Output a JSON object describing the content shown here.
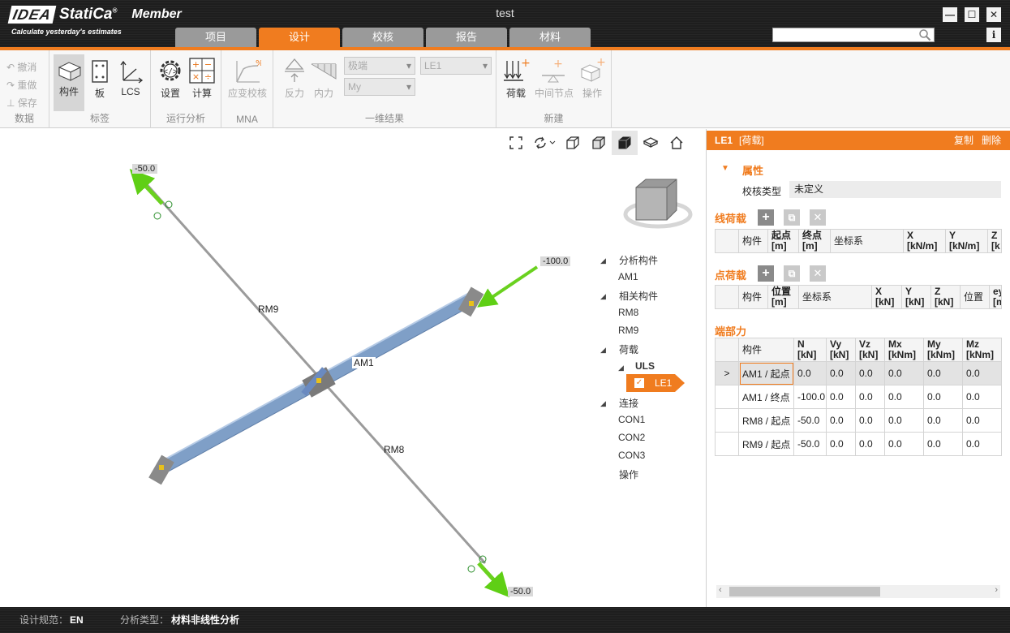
{
  "app": {
    "logo_idea": "IDEA",
    "logo_statica": "StatiCa",
    "logo_reg": "®",
    "product": "Member",
    "tagline": "Calculate yesterday's estimates",
    "document_title": "test"
  },
  "window": {
    "minimize": "—",
    "maximize": "☐",
    "close": "✕",
    "info": "i"
  },
  "search": {
    "value": "",
    "placeholder": ""
  },
  "tabs": [
    {
      "label": "项目",
      "active": false
    },
    {
      "label": "设计",
      "active": true
    },
    {
      "label": "校核",
      "active": false
    },
    {
      "label": "报告",
      "active": false
    },
    {
      "label": "材料",
      "active": false
    }
  ],
  "ribbon": {
    "data_group": {
      "undo": "撤消",
      "redo": "重做",
      "save": "保存",
      "label": "数据"
    },
    "labels_group": {
      "member": "构件",
      "plate": "板",
      "lcs": "LCS",
      "label": "标签"
    },
    "run_group": {
      "settings": "设置",
      "calculate": "计算",
      "label": "运行分析"
    },
    "mna_group": {
      "strain_check": "应变校核",
      "label": "MNA"
    },
    "results_group": {
      "reactions": "反力",
      "internal_forces": "内力",
      "extreme_dropdown": "极端",
      "my_dropdown": "My",
      "le1_dropdown": "LE1",
      "label": "一维结果"
    },
    "new_group": {
      "load": "荷载",
      "intermediate_node": "中间节点",
      "operation": "操作",
      "label": "新建"
    }
  },
  "viewport": {
    "load_labels": [
      "-50.0",
      "-100.0",
      "-50.0"
    ],
    "member_labels": [
      "RM9",
      "AM1",
      "RM8"
    ],
    "tree": {
      "analysis_members": "分析构件",
      "am1": "AM1",
      "related_members": "相关构件",
      "rm8": "RM8",
      "rm9": "RM9",
      "loads": "荷载",
      "uls": "ULS",
      "le1": "LE1",
      "connections": "连接",
      "con1": "CON1",
      "con2": "CON2",
      "con3": "CON3",
      "operations": "操作"
    }
  },
  "panel": {
    "header_title": "LE1",
    "header_type": "[荷载]",
    "copy": "复制",
    "delete": "删除",
    "properties_title": "属性",
    "check_type_label": "校核类型",
    "check_type_value": "未定义",
    "line_loads_title": "线荷载",
    "line_loads_columns": [
      "构件",
      "起点 [m]",
      "终点 [m]",
      "坐标系",
      "X [kN/m]",
      "Y [kN/m]",
      "Z [k"
    ],
    "point_loads_title": "点荷载",
    "point_loads_columns": [
      "构件",
      "位置 [m]",
      "坐标系",
      "X [kN]",
      "Y [kN]",
      "Z [kN]",
      "位置",
      "ey [m"
    ],
    "end_forces_title": "端部力",
    "end_forces_columns": [
      "构件",
      "N [kN]",
      "Vy [kN]",
      "Vz [kN]",
      "Mx [kNm]",
      "My [kNm]",
      "Mz [kNm]"
    ],
    "end_forces_rows": [
      [
        "AM1 / 起点",
        "0.0",
        "0.0",
        "0.0",
        "0.0",
        "0.0",
        "0.0"
      ],
      [
        "AM1 / 终点",
        "-100.0",
        "0.0",
        "0.0",
        "0.0",
        "0.0",
        "0.0"
      ],
      [
        "RM8 / 起点",
        "-50.0",
        "0.0",
        "0.0",
        "0.0",
        "0.0",
        "0.0"
      ],
      [
        "RM9 / 起点",
        "-50.0",
        "0.0",
        "0.0",
        "0.0",
        "0.0",
        "0.0"
      ]
    ]
  },
  "status": {
    "code_label": "设计规范：",
    "code_value": "EN",
    "analysis_label": "分析类型：",
    "analysis_value": "材料非线性分析"
  },
  "colors": {
    "accent": "#f07c1f",
    "dark": "#222222",
    "load_arrow": "#6ad11f",
    "member_blue": "#7f9fc7"
  }
}
